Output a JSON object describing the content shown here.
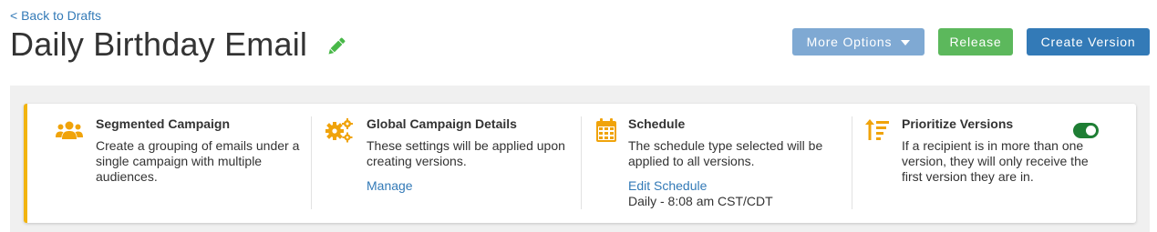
{
  "header": {
    "back_link": "< Back to Drafts",
    "title": "Daily Birthday Email",
    "edit_icon": "pencil-icon"
  },
  "toolbar": {
    "more_options_label": "More Options",
    "release_label": "Release",
    "create_version_label": "Create Version"
  },
  "colors": {
    "primary": "#337ab7",
    "success": "#5cb85c",
    "muted_primary": "#7fa9d3",
    "accent_border": "#f2b40f",
    "icon_orange": "#f0a30a",
    "toggle_on": "#1e7e34",
    "pencil_green": "#48b848"
  },
  "sections": {
    "segmented": {
      "icon": "users-icon",
      "title": "Segmented Campaign",
      "description": "Create a grouping of emails under a single campaign with multiple audiences."
    },
    "global": {
      "icon": "gears-icon",
      "title": "Global Campaign Details",
      "description": "These settings will be applied upon creating versions.",
      "link": "Manage"
    },
    "schedule": {
      "icon": "calendar-icon",
      "title": "Schedule",
      "description": "The schedule type selected will be applied to all versions.",
      "link": "Edit Schedule",
      "value": "Daily - 8:08 am CST/CDT"
    },
    "prioritize": {
      "icon": "sort-priority-icon",
      "title": "Prioritize Versions",
      "description": "If a recipient is in more than one version, they will only receive the first version they are in.",
      "toggle_on": true
    }
  }
}
